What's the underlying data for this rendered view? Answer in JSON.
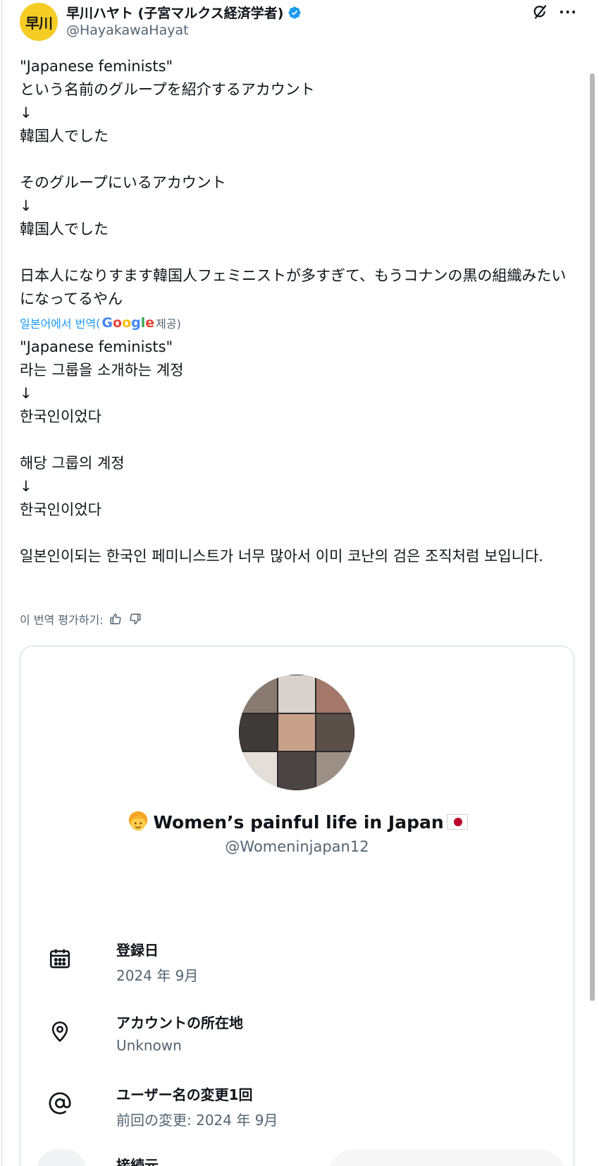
{
  "author": {
    "avatar_text": "早川",
    "display_name": "早川ハヤト (子宮マルクス経済学者)",
    "handle": "@HayakawaHayat",
    "verified": true
  },
  "header_icons": {
    "grok": "grok-icon",
    "more": "more-options-icon",
    "more_glyph": "···"
  },
  "tweet": {
    "text": "\"Japanese feminists\"\nという名前のグループを紹介するアカウント\n↓\n韓国人でした\n\nそのグループにいるアカウント\n↓\n韓国人でした\n\n日本人になりすます韓国人フェミニストが多すぎて、もうコナンの黒の組織みたいになってるやん"
  },
  "translation": {
    "link_text": "일본어에서 번역",
    "paren_open": "(",
    "google": [
      "G",
      "o",
      "o",
      "g",
      "l",
      "e"
    ],
    "provider_suffix": "제공)",
    "text": "\"Japanese feminists\"\n라는 그룹을 소개하는 계정\n↓\n한국인이었다\n\n해당 그룹의 계정\n↓\n한국인이었다\n\n일본인이되는 한국인 페미니스트가 너무 많아서 이미 코난의 검은 조직처럼 보입니다.",
    "rate_label": "이 번역 평가하기:"
  },
  "card": {
    "profile_name": "Women’s painful life in Japan",
    "profile_handle": "@Womeninjapan12",
    "rows": [
      {
        "icon": "calendar-icon",
        "label": "登録日",
        "value": "2024 年 9月"
      },
      {
        "icon": "location-pin-icon",
        "label": "アカウントの所在地",
        "value": "Unknown"
      },
      {
        "icon": "at-sign-icon",
        "label": "ユーザー名の変更1回",
        "value": "前回の変更: 2024 年 9月"
      },
      {
        "icon": "connection-icon",
        "label": "接続元",
        "value": ""
      }
    ]
  },
  "colors": {
    "accent": "#1d9bf0",
    "avatar_bg": "#f5cc24",
    "text": "#0f1419",
    "muted": "#536471",
    "border": "#cfd9de"
  }
}
